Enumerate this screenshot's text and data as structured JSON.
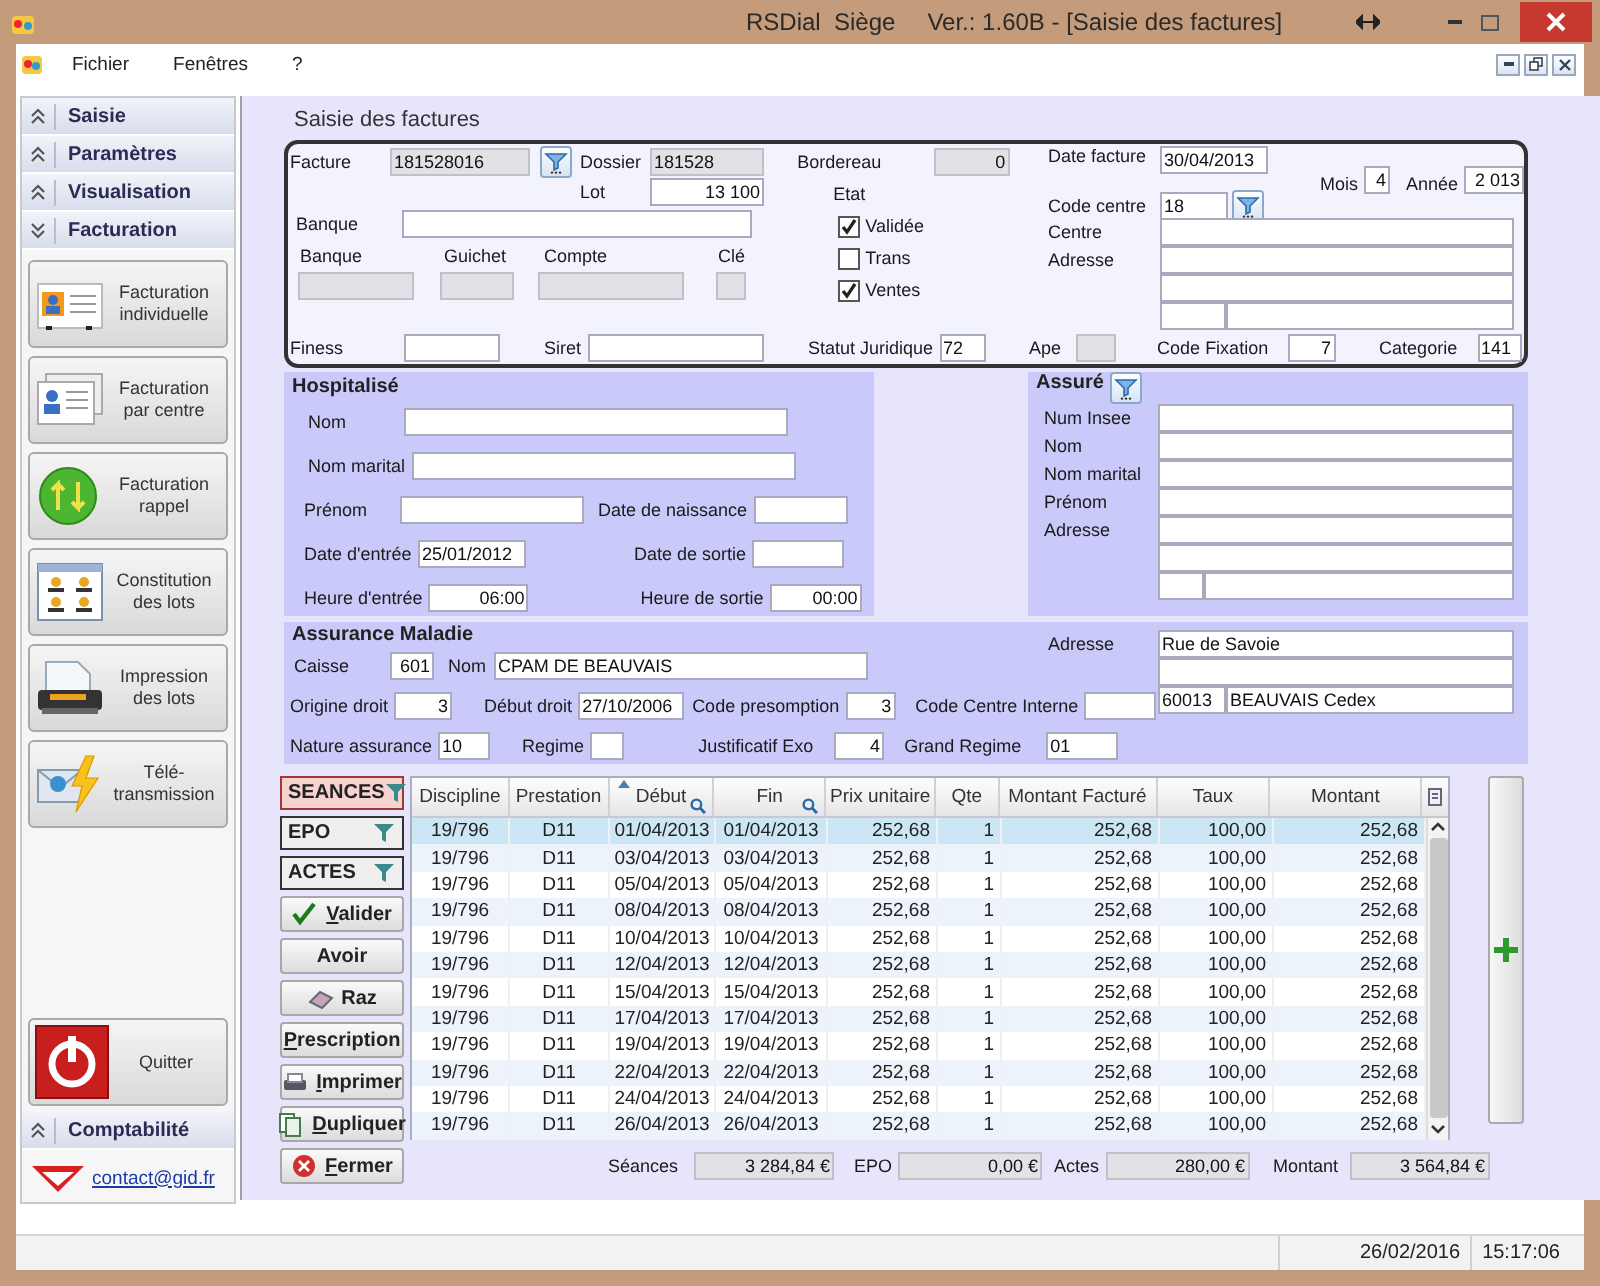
{
  "window": {
    "title": "RSDial  Siège",
    "subtitle": "Ver.: 1.60B - [Saisie des factures]"
  },
  "menu": [
    {
      "label": "Fichier"
    },
    {
      "label": "Fenêtres"
    },
    {
      "label": "?"
    }
  ],
  "sidebar": {
    "sections": [
      {
        "label": "Saisie",
        "expanded": false
      },
      {
        "label": "Paramètres",
        "expanded": false
      },
      {
        "label": "Visualisation",
        "expanded": false
      },
      {
        "label": "Facturation",
        "expanded": true
      }
    ],
    "tools": [
      {
        "label": "Facturation individuelle",
        "kind": "card"
      },
      {
        "label": "Facturation par centre",
        "kind": "cards"
      },
      {
        "label": "Facturation rappel",
        "kind": "cycle"
      },
      {
        "label": "Constitution des lots",
        "kind": "grid"
      },
      {
        "label": "Impression des lots",
        "kind": "printer"
      },
      {
        "label": "Télé-transmission",
        "kind": "mail"
      }
    ],
    "quit": {
      "label": "Quitter"
    },
    "footer_section": {
      "label": "Comptabilité",
      "expanded": false
    },
    "contact": "contact@gid.fr"
  },
  "form": {
    "title": "Saisie des factures",
    "header": {
      "facture": {
        "label": "Facture",
        "value": "181528016",
        "readonly": true
      },
      "dossier": {
        "label": "Dossier",
        "value": "181528",
        "readonly": true
      },
      "lot": {
        "label": "Lot",
        "value": "13 100",
        "readonly": false
      },
      "banque": {
        "label": "Banque",
        "readonly": false
      },
      "banque_code": {
        "label": "Banque",
        "readonly": true
      },
      "guichet": {
        "label": "Guichet",
        "readonly": true
      },
      "compte": {
        "label": "Compte",
        "readonly": true
      },
      "cle": {
        "label": "Clé",
        "readonly": true
      },
      "bordereau": {
        "label": "Bordereau",
        "value": "0",
        "readonly": true
      },
      "etat": {
        "label": "Etat",
        "options": [
          {
            "label": "Validée",
            "checked": true
          },
          {
            "label": "Trans",
            "checked": false
          },
          {
            "label": "Ventes",
            "checked": true
          }
        ]
      },
      "date_facture": {
        "label": "Date facture",
        "value": "30/04/2013",
        "readonly": false
      },
      "mois": {
        "label": "Mois",
        "value": "4",
        "readonly": false
      },
      "annee": {
        "label": "Année",
        "value": "2 013",
        "readonly": false
      },
      "code_centre": {
        "label": "Code centre",
        "value": "18",
        "readonly": false
      },
      "centre": {
        "label": "Centre",
        "readonly": false
      },
      "adresse": {
        "label": "Adresse",
        "readonly": false
      },
      "finess": {
        "label": "Finess",
        "readonly": false
      },
      "siret": {
        "label": "Siret",
        "readonly": false
      },
      "statut_juridique": {
        "label": "Statut Juridique",
        "value": "72",
        "readonly": false
      },
      "ape": {
        "label": "Ape",
        "readonly": true
      },
      "code_fixation": {
        "label": "Code Fixation",
        "value": "7",
        "readonly": false
      },
      "categorie": {
        "label": "Categorie",
        "value": "141",
        "readonly": false
      }
    },
    "hospitalise": {
      "title": "Hospitalisé",
      "nom": {
        "label": "Nom",
        "readonly": false
      },
      "nom_marital": {
        "label": "Nom marital",
        "readonly": false
      },
      "prenom": {
        "label": "Prénom",
        "readonly": false
      },
      "date_naissance": {
        "label": "Date de naissance",
        "readonly": false
      },
      "date_entree": {
        "label": "Date d'entrée",
        "value": "25/01/2012",
        "readonly": false
      },
      "date_sortie": {
        "label": "Date de sortie",
        "readonly": false
      },
      "heure_entree": {
        "label": "Heure d'entrée",
        "value": "06:00",
        "readonly": false
      },
      "heure_sortie": {
        "label": "Heure de sortie",
        "value": "00:00",
        "readonly": false
      }
    },
    "assure": {
      "title": "Assuré",
      "num_insee": {
        "label": "Num Insee",
        "readonly": false
      },
      "nom": {
        "label": "Nom",
        "readonly": false
      },
      "nom_marital": {
        "label": "Nom marital",
        "readonly": false
      },
      "prenom": {
        "label": "Prénom",
        "readonly": false
      },
      "adresse": {
        "label": "Adresse",
        "readonly": false
      }
    },
    "assurance": {
      "title": "Assurance Maladie",
      "caisse": {
        "label": "Caisse",
        "value": "601",
        "readonly": false
      },
      "nom": {
        "label": "Nom",
        "value": "CPAM DE BEAUVAIS",
        "readonly": false
      },
      "adresse": {
        "label": "Adresse",
        "readonly": false,
        "line_1": "Rue de Savoie",
        "postcode": "60013",
        "city": "BEAUVAIS Cedex"
      },
      "origine_droit": {
        "label": "Origine droit",
        "value": "3",
        "readonly": false
      },
      "debut_droit": {
        "label": "Début droit",
        "value": "27/10/2006",
        "readonly": false
      },
      "code_presomption": {
        "label": "Code presomption",
        "value": "3",
        "readonly": false
      },
      "code_centre_interne": {
        "label": "Code Centre Interne",
        "readonly": false
      },
      "nature_assurance": {
        "label": "Nature assurance",
        "value": "10",
        "readonly": false
      },
      "regime": {
        "label": "Regime",
        "readonly": false
      },
      "justificatif_exo": {
        "label": "Justificatif Exo",
        "value": "4",
        "readonly": false
      },
      "grand_regime": {
        "label": "Grand Regime",
        "value": "01",
        "readonly": false
      }
    }
  },
  "actions": {
    "filters": [
      {
        "label": "SEANCES",
        "selected": true
      },
      {
        "label": "EPO",
        "selected": false
      },
      {
        "label": "ACTES",
        "selected": false
      }
    ],
    "buttons": [
      {
        "label": "Valider",
        "kind": "check",
        "mnemonic": true
      },
      {
        "label": "Avoir",
        "kind": "plain",
        "mnemonic": false
      },
      {
        "label": "Raz",
        "kind": "eraser",
        "mnemonic": false
      },
      {
        "label": "Prescription",
        "kind": "plain",
        "mnemonic": true
      },
      {
        "label": "Imprimer",
        "kind": "printer",
        "mnemonic": true
      },
      {
        "label": "Dupliquer",
        "kind": "copy",
        "mnemonic": true
      },
      {
        "label": "Fermer",
        "kind": "close",
        "mnemonic": true
      }
    ]
  },
  "table": {
    "columns": [
      {
        "label": "Discipline",
        "sorted": false,
        "search": false
      },
      {
        "label": "Prestation",
        "sorted": false,
        "search": false
      },
      {
        "label": "Début",
        "sorted": true,
        "search": true
      },
      {
        "label": "Fin",
        "sorted": false,
        "search": true
      },
      {
        "label": "Prix unitaire",
        "sorted": false,
        "search": false
      },
      {
        "label": "Qte",
        "sorted": false,
        "search": false
      },
      {
        "label": "Montant Facturé",
        "sorted": false,
        "search": false
      },
      {
        "label": "Taux",
        "sorted": false,
        "search": false
      },
      {
        "label": "Montant",
        "sorted": false,
        "search": false
      }
    ],
    "rows": [
      {
        "cells": [
          "19/796",
          "D11",
          "01/04/2013",
          "01/04/2013",
          "252,68",
          "1",
          "252,68",
          "100,00",
          "252,68"
        ],
        "selected": true
      },
      {
        "cells": [
          "19/796",
          "D11",
          "03/04/2013",
          "03/04/2013",
          "252,68",
          "1",
          "252,68",
          "100,00",
          "252,68"
        ],
        "selected": false
      },
      {
        "cells": [
          "19/796",
          "D11",
          "05/04/2013",
          "05/04/2013",
          "252,68",
          "1",
          "252,68",
          "100,00",
          "252,68"
        ],
        "selected": false
      },
      {
        "cells": [
          "19/796",
          "D11",
          "08/04/2013",
          "08/04/2013",
          "252,68",
          "1",
          "252,68",
          "100,00",
          "252,68"
        ],
        "selected": false
      },
      {
        "cells": [
          "19/796",
          "D11",
          "10/04/2013",
          "10/04/2013",
          "252,68",
          "1",
          "252,68",
          "100,00",
          "252,68"
        ],
        "selected": false
      },
      {
        "cells": [
          "19/796",
          "D11",
          "12/04/2013",
          "12/04/2013",
          "252,68",
          "1",
          "252,68",
          "100,00",
          "252,68"
        ],
        "selected": false
      },
      {
        "cells": [
          "19/796",
          "D11",
          "15/04/2013",
          "15/04/2013",
          "252,68",
          "1",
          "252,68",
          "100,00",
          "252,68"
        ],
        "selected": false
      },
      {
        "cells": [
          "19/796",
          "D11",
          "17/04/2013",
          "17/04/2013",
          "252,68",
          "1",
          "252,68",
          "100,00",
          "252,68"
        ],
        "selected": false
      },
      {
        "cells": [
          "19/796",
          "D11",
          "19/04/2013",
          "19/04/2013",
          "252,68",
          "1",
          "252,68",
          "100,00",
          "252,68"
        ],
        "selected": false
      },
      {
        "cells": [
          "19/796",
          "D11",
          "22/04/2013",
          "22/04/2013",
          "252,68",
          "1",
          "252,68",
          "100,00",
          "252,68"
        ],
        "selected": false
      },
      {
        "cells": [
          "19/796",
          "D11",
          "24/04/2013",
          "24/04/2013",
          "252,68",
          "1",
          "252,68",
          "100,00",
          "252,68"
        ],
        "selected": false
      },
      {
        "cells": [
          "19/796",
          "D11",
          "26/04/2013",
          "26/04/2013",
          "252,68",
          "1",
          "252,68",
          "100,00",
          "252,68"
        ],
        "selected": false
      }
    ]
  },
  "totals": [
    {
      "label": "Séances",
      "value": "3 284,84 €",
      "readonly": true
    },
    {
      "label": "EPO",
      "value": "0,00 €",
      "readonly": true
    },
    {
      "label": "Actes",
      "value": "280,00 €",
      "readonly": true
    },
    {
      "label": "Montant",
      "value": "3 564,84 €",
      "readonly": true
    }
  ],
  "status_bar": {
    "date": "26/02/2016",
    "time": "15:17:06"
  }
}
